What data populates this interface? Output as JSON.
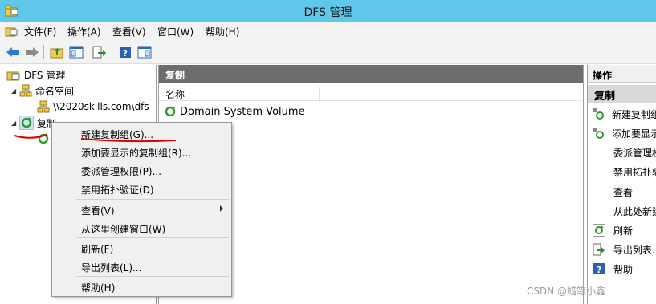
{
  "window": {
    "title": "DFS 管理"
  },
  "menubar": {
    "items": [
      "文件(F)",
      "操作(A)",
      "查看(V)",
      "窗口(W)",
      "帮助(H)"
    ]
  },
  "tree": {
    "root": "DFS 管理",
    "namespaces": "命名空间",
    "namespace_path": "\\\\2020skills.com\\dfs-",
    "replication": "复制"
  },
  "center": {
    "header": "复制",
    "column_name": "名称",
    "rows": [
      "Domain System Volume"
    ]
  },
  "right": {
    "header": "操作",
    "section": "复制",
    "actions": [
      "新建复制组",
      "添加要显示",
      "委派管理权",
      "禁用拓扑验",
      "查看",
      "从此处新建",
      "刷新",
      "导出列表...",
      "帮助"
    ]
  },
  "context_menu": {
    "items": [
      "新建复制组(G)...",
      "添加要显示的复制组(R)...",
      "委派管理权限(P)...",
      "禁用拓扑验证(D)",
      "查看(V)",
      "从这里创建窗口(W)",
      "刷新(F)",
      "导出列表(L)...",
      "帮助(H)"
    ]
  },
  "watermark": "CSDN @蜡笔小鑫",
  "colors": {
    "titlebar": "#5fc7ea",
    "pane_header": "#6d6d6d",
    "annotation": "#e00000"
  }
}
